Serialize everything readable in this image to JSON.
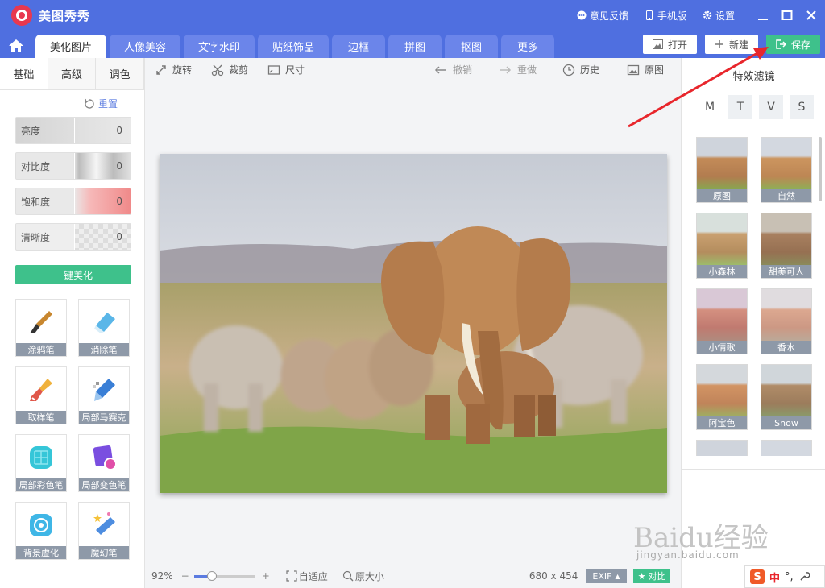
{
  "app": {
    "title": "美图秀秀"
  },
  "titlebar": {
    "feedback": "意见反馈",
    "mobile": "手机版",
    "settings": "设置"
  },
  "tabs": [
    "美化图片",
    "人像美容",
    "文字水印",
    "贴纸饰品",
    "边框",
    "拼图",
    "抠图",
    "更多"
  ],
  "actions": {
    "open": "打开",
    "new": "新建",
    "save": "保存"
  },
  "left": {
    "subtabs": [
      "基础",
      "高级",
      "调色"
    ],
    "reset": "重置",
    "sliders": [
      {
        "label": "亮度",
        "value": "0"
      },
      {
        "label": "对比度",
        "value": "0"
      },
      {
        "label": "饱和度",
        "value": "0"
      },
      {
        "label": "清晰度",
        "value": "0"
      }
    ],
    "onekey": "一键美化",
    "tools": [
      "涂鸦笔",
      "消除笔",
      "取样笔",
      "局部马赛克",
      "局部彩色笔",
      "局部变色笔",
      "背景虚化",
      "魔幻笔"
    ]
  },
  "toolbar": {
    "rotate": "旋转",
    "crop": "裁剪",
    "size": "尺寸",
    "undo": "撤销",
    "redo": "重做",
    "history": "历史",
    "original": "原图"
  },
  "bottom": {
    "zoom": "92%",
    "fit": "自适应",
    "actual": "原大小",
    "dims": "680 x 454",
    "exif": "EXIF",
    "compare": "对比"
  },
  "right": {
    "title": "特效滤镜",
    "categories": [
      "M",
      "T",
      "V",
      "S"
    ],
    "filters": [
      "原图",
      "自然",
      "小森林",
      "甜美可人",
      "小情歌",
      "香水",
      "阿宝色",
      "Snow"
    ]
  },
  "watermark": {
    "brand": "Baidu经验",
    "url": "jingyan.baidu.com"
  },
  "ime": {
    "logo": "S",
    "lang": "中",
    "punct": "°,"
  },
  "colors": {
    "primary": "#4f6fe0",
    "green": "#3ec18b",
    "arrow": "#e8262c"
  }
}
